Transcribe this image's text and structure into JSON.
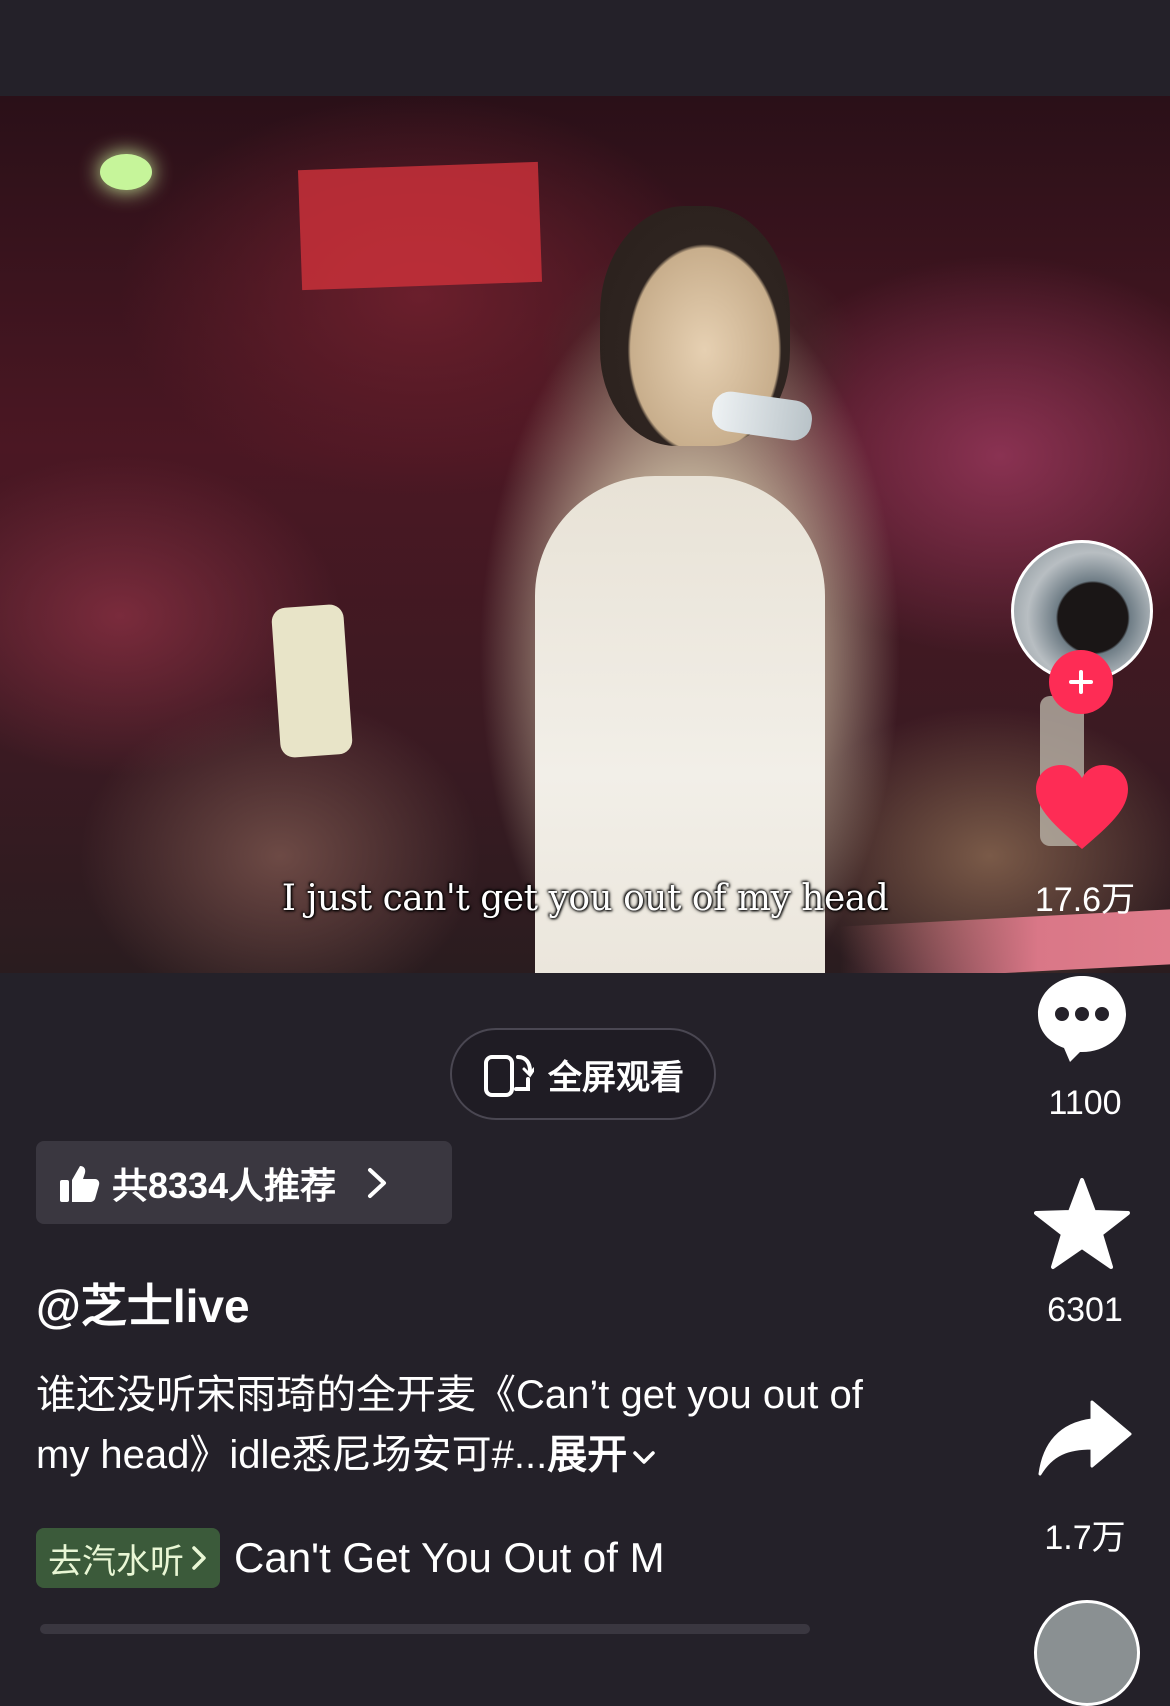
{
  "video": {
    "subtitle": "I just can't get you out of my head"
  },
  "actions": {
    "like_count": "17.6万",
    "comment_count": "1100",
    "favorite_count": "6301",
    "share_count": "1.7万",
    "like_color": "#fe2c55",
    "follow_color": "#fe2c55"
  },
  "fullscreen": {
    "label": "全屏观看"
  },
  "recommend": {
    "label": "共8334人推荐"
  },
  "post": {
    "author": "@芝士live",
    "description": "谁还没听宋雨琦的全开麦《Can’t get you out of my head》idle悉尼场安可#...",
    "expand_label": "展开"
  },
  "music": {
    "tag_label": "去汽水听",
    "title": "Can't Get You Out of M",
    "tag_color": "#3b5a3a"
  }
}
